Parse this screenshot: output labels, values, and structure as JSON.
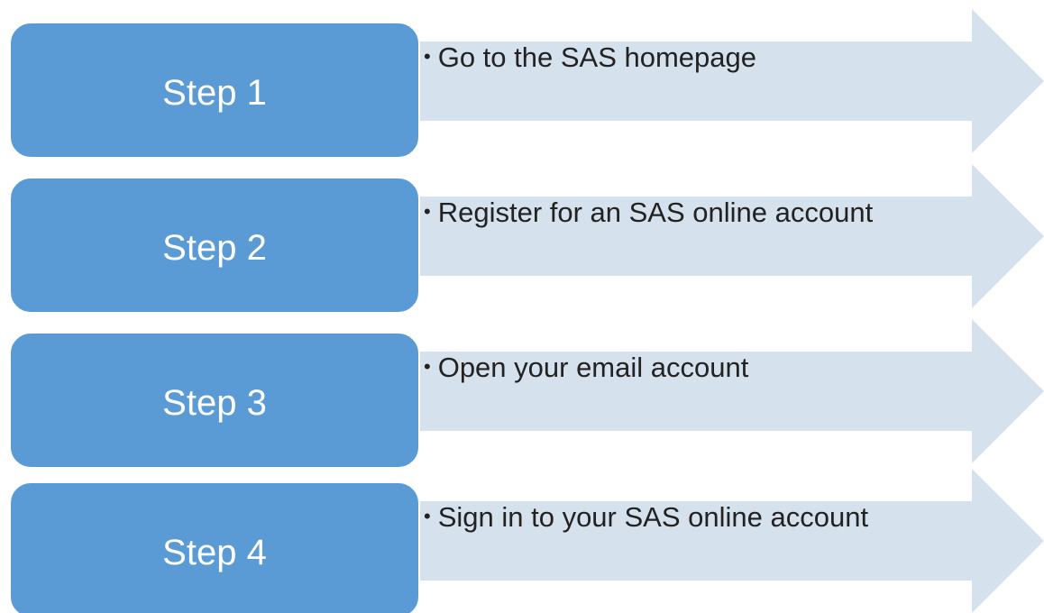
{
  "colors": {
    "step_box_fill": "#5b9bd5",
    "arrow_fill": "#d6e1ee",
    "step_text": "#ffffff",
    "bullet_text": "#222222"
  },
  "steps": [
    {
      "label": "Step 1",
      "description": "Go to the SAS homepage"
    },
    {
      "label": "Step 2",
      "description": "Register for an SAS online account"
    },
    {
      "label": "Step 3",
      "description": "Open your email account"
    },
    {
      "label": "Step 4",
      "description": "Sign in to your SAS online account"
    }
  ]
}
